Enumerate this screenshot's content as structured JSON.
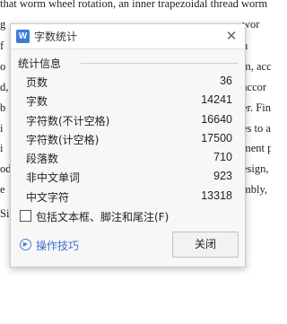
{
  "document": {
    "line_top": "that worm wheel rotation, an inner trapezoidal thread worm",
    "right_fragments": [
      "wor",
      "n",
      "m, acc",
      "accor",
      "er. Fina",
      "es to a",
      "ment p",
      "esign,",
      "mbly,"
    ],
    "left_fragments": [
      "g",
      "f",
      "o",
      "d, v",
      "b",
      "i",
      "i",
      "odi",
      "e",
      "SiLi"
    ]
  },
  "dialog": {
    "title": "字数统计",
    "app_icon": "W",
    "close_glyph": "✕",
    "section_label": "统计信息",
    "stats": [
      {
        "label": "页数",
        "value": "36"
      },
      {
        "label": "字数",
        "value": "14241"
      },
      {
        "label": "字符数(不计空格)",
        "value": "16640"
      },
      {
        "label": "字符数(计空格)",
        "value": "17500"
      },
      {
        "label": "段落数",
        "value": "710"
      },
      {
        "label": "非中文单词",
        "value": "923"
      },
      {
        "label": "中文字符",
        "value": "13318"
      }
    ],
    "checkbox_label": "包括文本框、脚注和尾注(F)",
    "checkbox_checked": false,
    "tips_label": "操作技巧",
    "tips_icon": "play-circle-icon",
    "close_button_label": "关闭"
  },
  "colors": {
    "accent": "#3d72c9",
    "app_icon_bg": "#3d7bd9"
  }
}
